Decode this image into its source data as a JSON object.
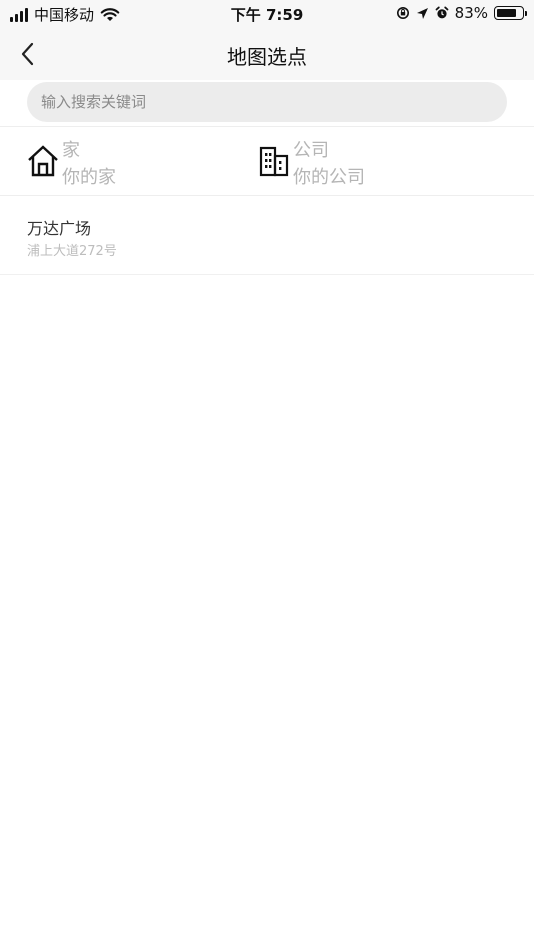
{
  "status_bar": {
    "carrier": "中国移动",
    "time": "下午 7:59",
    "battery_percent": "83%",
    "battery_level": 0.83,
    "icons": [
      "signal-icon",
      "wifi-icon",
      "rotation-lock-icon",
      "location-arrow-icon",
      "alarm-icon",
      "battery-icon"
    ]
  },
  "nav": {
    "title": "地图选点",
    "back_icon": "chevron-left-icon"
  },
  "search": {
    "placeholder": "输入搜索关键词",
    "value": ""
  },
  "shortcuts": {
    "home": {
      "icon": "home-icon",
      "title": "家",
      "subtitle": "你的家"
    },
    "office": {
      "icon": "building-icon",
      "title": "公司",
      "subtitle": "你的公司"
    }
  },
  "results": [
    {
      "name": "万达广场",
      "address": "浦上大道272号"
    }
  ]
}
